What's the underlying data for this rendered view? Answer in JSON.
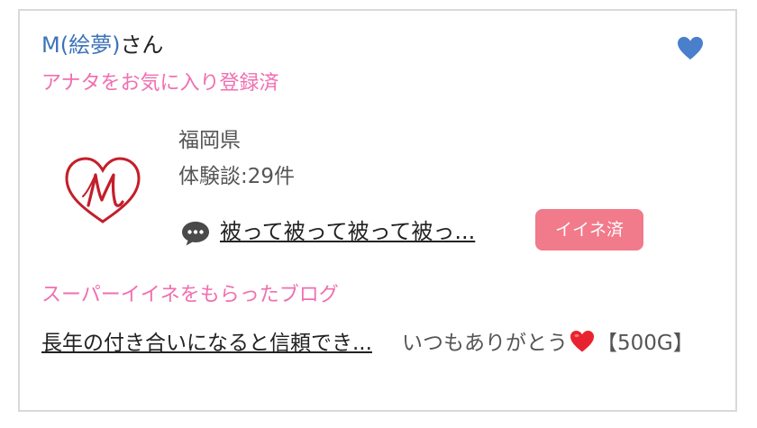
{
  "user": {
    "name": "M(絵夢)",
    "suffix": "さん",
    "favorite_status": "アナタをお気に入り登録済"
  },
  "profile": {
    "prefecture": "福岡県",
    "reports": "体験談:29件"
  },
  "post": {
    "title": "被って被って被って被っ..."
  },
  "like_button": {
    "label": "イイネ済"
  },
  "super_like": {
    "section_title": "スーパーイイネをもらったブログ",
    "blog_title": "長年の付き合いになると信頼でき...",
    "comment_before": "いつもありがとう",
    "comment_after": "【500G】"
  },
  "icons": {
    "favorite": "heart-icon",
    "logo": "heart-m-logo",
    "comment": "speech-bubble-icon",
    "emoji": "red-heart-emoji"
  },
  "colors": {
    "name_blue": "#3b73b9",
    "pink_text": "#f06fb0",
    "like_button": "#f17a8b",
    "heart_blue": "#4a7fcb",
    "logo_red": "#c41e2a",
    "emoji_red": "#e8232f"
  }
}
